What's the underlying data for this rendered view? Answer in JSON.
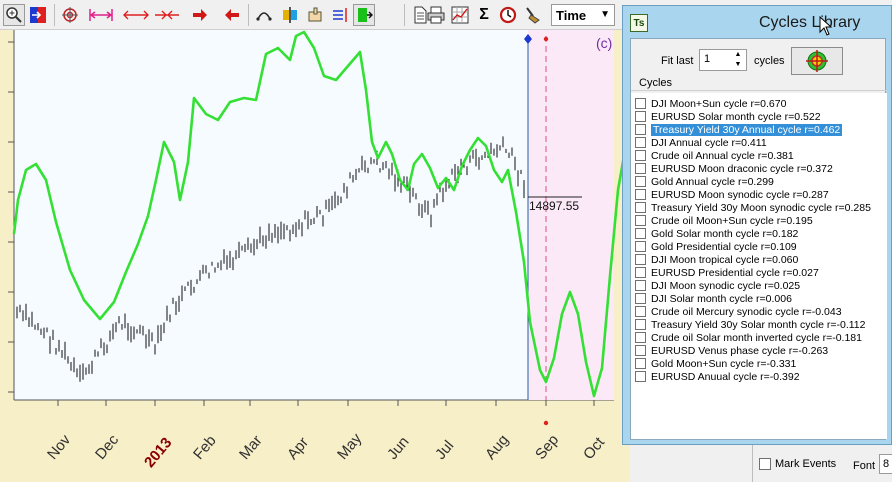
{
  "toolbar": {
    "icons": [
      "zoom-icon",
      "color-swap-icon",
      "target-icon",
      "fit-width-icon",
      "expand-horizontal-icon",
      "compress-horizontal-icon",
      "arrow-right-icon",
      "arrow-left-icon",
      "arc-icon",
      "vertical-split-icon",
      "hand-pointer-icon",
      "align-bars-icon",
      "green-marker-icon",
      "document-icon",
      "print-icon",
      "chart-grid-icon",
      "sigma-icon",
      "clock-arrow-icon",
      "broom-icon"
    ],
    "sigma_glyph": "Σ",
    "time_select": "Time"
  },
  "chart": {
    "corner_label": "(c)",
    "price_label": "14897.55",
    "x_labels": [
      {
        "text": "Nov",
        "year": false
      },
      {
        "text": "Dec",
        "year": false
      },
      {
        "text": "2013",
        "year": true
      },
      {
        "text": "Feb",
        "year": false
      },
      {
        "text": "Mar",
        "year": false
      },
      {
        "text": "Apr",
        "year": false
      },
      {
        "text": "May",
        "year": false
      },
      {
        "text": "Jun",
        "year": false
      },
      {
        "text": "Jul",
        "year": false
      },
      {
        "text": "Aug",
        "year": false
      },
      {
        "text": "Sep",
        "year": false
      },
      {
        "text": "Oct",
        "year": false
      }
    ],
    "colors": {
      "cycle": "#33e033",
      "price": "#000000",
      "future_zone": "#fbe9f7",
      "today_line": "#2060a0",
      "background": "#f7efc8",
      "plot": "#f5fbff"
    }
  },
  "dialog": {
    "title": "Cycles Library",
    "icon_text": "Ts",
    "fit_last_label": "Fit last",
    "fit_last_value": "1",
    "cycles_label": "cycles",
    "list_header": "Cycles",
    "selected_index": 2,
    "cycles": [
      "DJI Moon+Sun cycle  r=0.670",
      "EURUSD Solar month cycle  r=0.522",
      "Treasury Yield 30y Annual cycle  r=0.462",
      "DJI Annual cycle  r=0.411",
      "Crude oil Annual cycle  r=0.381",
      "EURUSD Moon draconic cycle  r=0.372",
      "Gold Annual cycle  r=0.299",
      "EURUSD Moon synodic cycle  r=0.287",
      "Treasury Yield 30y Moon synodic cycle  r=0.285",
      "Crude oil Moon+Sun cycle  r=0.195",
      "Gold Solar month cycle  r=0.182",
      "Gold Presidential cycle  r=0.109",
      "DJI Moon tropical cycle  r=0.060",
      "EURUSD Presidential cycle  r=0.027",
      "DJI Moon synodic cycle  r=0.025",
      "DJI Solar month cycle  r=0.006",
      "Crude oil Mercury synodic cycle  r=-0.043",
      "Treasury Yield 30y Solar month cycle  r=-0.112",
      "Crude oil Solar month inverted cycle  r=-0.181",
      "EURUSD Venus phase cycle  r=-0.263",
      "Gold Moon+Sun cycle  r=-0.331",
      "EURUSD Anuual cycle  r=-0.392"
    ]
  },
  "side_panel": {
    "mark_events_label": "Mark Events",
    "font_label": "Font",
    "font_value": "8"
  }
}
